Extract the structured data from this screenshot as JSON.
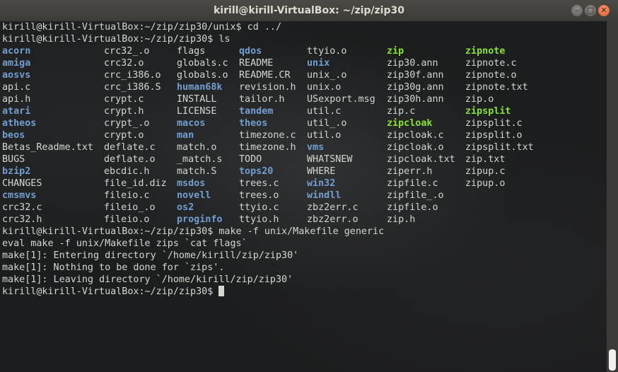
{
  "window": {
    "title": "kirill@kirill-VirtualBox: ~/zip/zip30",
    "minimize_glyph": "–",
    "maximize_glyph": "□",
    "close_glyph": "✕"
  },
  "colors": {
    "text": "#d3d7cf",
    "directory": "#729fcf",
    "executable": "#8ae234",
    "close_button": "#e0582c"
  },
  "terminal": {
    "prompt_user": "kirill@kirill-VirtualBox",
    "lines_before": [
      "kirill@kirill-VirtualBox:~/zip/zip30/unix$ cd ../",
      "kirill@kirill-VirtualBox:~/zip/zip30$ ls"
    ],
    "ls_columns": [
      [
        {
          "name": "acorn",
          "type": "dir"
        },
        {
          "name": "amiga",
          "type": "dir"
        },
        {
          "name": "aosvs",
          "type": "dir"
        },
        {
          "name": "api.c",
          "type": "file"
        },
        {
          "name": "api.h",
          "type": "file"
        },
        {
          "name": "atari",
          "type": "dir"
        },
        {
          "name": "atheos",
          "type": "dir"
        },
        {
          "name": "beos",
          "type": "dir"
        },
        {
          "name": "Betas_Readme.txt",
          "type": "file"
        },
        {
          "name": "BUGS",
          "type": "file"
        },
        {
          "name": "bzip2",
          "type": "dir"
        },
        {
          "name": "CHANGES",
          "type": "file"
        },
        {
          "name": "cmsmvs",
          "type": "dir"
        },
        {
          "name": "crc32.c",
          "type": "file"
        },
        {
          "name": "crc32.h",
          "type": "file"
        }
      ],
      [
        {
          "name": "crc32_.o",
          "type": "file"
        },
        {
          "name": "crc32.o",
          "type": "file"
        },
        {
          "name": "crc_i386.o",
          "type": "file"
        },
        {
          "name": "crc_i386.S",
          "type": "file"
        },
        {
          "name": "crypt.c",
          "type": "file"
        },
        {
          "name": "crypt.h",
          "type": "file"
        },
        {
          "name": "crypt_.o",
          "type": "file"
        },
        {
          "name": "crypt.o",
          "type": "file"
        },
        {
          "name": "deflate.c",
          "type": "file"
        },
        {
          "name": "deflate.o",
          "type": "file"
        },
        {
          "name": "ebcdic.h",
          "type": "file"
        },
        {
          "name": "file_id.diz",
          "type": "file"
        },
        {
          "name": "fileio.c",
          "type": "file"
        },
        {
          "name": "fileio_.o",
          "type": "file"
        },
        {
          "name": "fileio.o",
          "type": "file"
        }
      ],
      [
        {
          "name": "flags",
          "type": "file"
        },
        {
          "name": "globals.c",
          "type": "file"
        },
        {
          "name": "globals.o",
          "type": "file"
        },
        {
          "name": "human68k",
          "type": "dir"
        },
        {
          "name": "INSTALL",
          "type": "file"
        },
        {
          "name": "LICENSE",
          "type": "file"
        },
        {
          "name": "macos",
          "type": "dir"
        },
        {
          "name": "man",
          "type": "dir"
        },
        {
          "name": "match.o",
          "type": "file"
        },
        {
          "name": "_match.s",
          "type": "file"
        },
        {
          "name": "match.S",
          "type": "file"
        },
        {
          "name": "msdos",
          "type": "dir"
        },
        {
          "name": "novell",
          "type": "dir"
        },
        {
          "name": "os2",
          "type": "dir"
        },
        {
          "name": "proginfo",
          "type": "dir"
        }
      ],
      [
        {
          "name": "qdos",
          "type": "dir"
        },
        {
          "name": "README",
          "type": "file"
        },
        {
          "name": "README.CR",
          "type": "file"
        },
        {
          "name": "revision.h",
          "type": "file"
        },
        {
          "name": "tailor.h",
          "type": "file"
        },
        {
          "name": "tandem",
          "type": "dir"
        },
        {
          "name": "theos",
          "type": "dir"
        },
        {
          "name": "timezone.c",
          "type": "file"
        },
        {
          "name": "timezone.h",
          "type": "file"
        },
        {
          "name": "TODO",
          "type": "file"
        },
        {
          "name": "tops20",
          "type": "dir"
        },
        {
          "name": "trees.c",
          "type": "file"
        },
        {
          "name": "trees.o",
          "type": "file"
        },
        {
          "name": "ttyio.c",
          "type": "file"
        },
        {
          "name": "ttyio.h",
          "type": "file"
        }
      ],
      [
        {
          "name": "ttyio.o",
          "type": "file"
        },
        {
          "name": "unix",
          "type": "dir"
        },
        {
          "name": "unix_.o",
          "type": "file"
        },
        {
          "name": "unix.o",
          "type": "file"
        },
        {
          "name": "USexport.msg",
          "type": "file"
        },
        {
          "name": "util.c",
          "type": "file"
        },
        {
          "name": "util_.o",
          "type": "file"
        },
        {
          "name": "util.o",
          "type": "file"
        },
        {
          "name": "vms",
          "type": "dir"
        },
        {
          "name": "WHATSNEW",
          "type": "file"
        },
        {
          "name": "WHERE",
          "type": "file"
        },
        {
          "name": "win32",
          "type": "dir"
        },
        {
          "name": "windll",
          "type": "dir"
        },
        {
          "name": "zbz2err.c",
          "type": "file"
        },
        {
          "name": "zbz2err.o",
          "type": "file"
        }
      ],
      [
        {
          "name": "zip",
          "type": "exe"
        },
        {
          "name": "zip30.ann",
          "type": "file"
        },
        {
          "name": "zip30f.ann",
          "type": "file"
        },
        {
          "name": "zip30g.ann",
          "type": "file"
        },
        {
          "name": "zip30h.ann",
          "type": "file"
        },
        {
          "name": "zip.c",
          "type": "file"
        },
        {
          "name": "zipcloak",
          "type": "exe"
        },
        {
          "name": "zipcloak.c",
          "type": "file"
        },
        {
          "name": "zipcloak.o",
          "type": "file"
        },
        {
          "name": "zipcloak.txt",
          "type": "file"
        },
        {
          "name": "ziperr.h",
          "type": "file"
        },
        {
          "name": "zipfile.c",
          "type": "file"
        },
        {
          "name": "zipfile_.o",
          "type": "file"
        },
        {
          "name": "zipfile.o",
          "type": "file"
        },
        {
          "name": "zip.h",
          "type": "file"
        }
      ],
      [
        {
          "name": "zipnote",
          "type": "exe"
        },
        {
          "name": "zipnote.c",
          "type": "file"
        },
        {
          "name": "zipnote.o",
          "type": "file"
        },
        {
          "name": "zipnote.txt",
          "type": "file"
        },
        {
          "name": "zip.o",
          "type": "file"
        },
        {
          "name": "zipsplit",
          "type": "exe"
        },
        {
          "name": "zipsplit.c",
          "type": "file"
        },
        {
          "name": "zipsplit.o",
          "type": "file"
        },
        {
          "name": "zipsplit.txt",
          "type": "file"
        },
        {
          "name": "zip.txt",
          "type": "file"
        },
        {
          "name": "zipup.c",
          "type": "file"
        },
        {
          "name": "zipup.o",
          "type": "file"
        }
      ]
    ],
    "lines_after": [
      "kirill@kirill-VirtualBox:~/zip/zip30$ make -f unix/Makefile generic",
      "eval make -f unix/Makefile zips `cat flags`",
      "make[1]: Entering directory `/home/kirill/zip/zip30'",
      "make[1]: Nothing to be done for `zips'.",
      "make[1]: Leaving directory `/home/kirill/zip/zip30'"
    ],
    "current_prompt": "kirill@kirill-VirtualBox:~/zip/zip30$ "
  }
}
